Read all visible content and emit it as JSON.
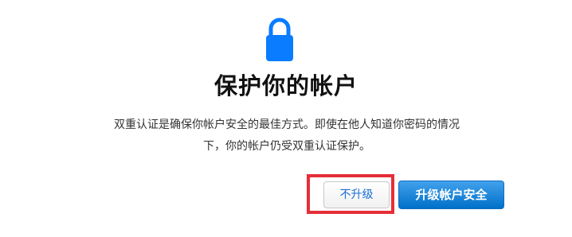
{
  "header": {
    "icon": "lock-icon",
    "title": "保护你的帐户"
  },
  "body": {
    "description_line1": "双重认证是确保你帐户安全的最佳方式。即使在他人知道你密码的情况",
    "description_line2": "下，你的帐户仍受双重认证保护。"
  },
  "actions": {
    "decline_label": "不升级",
    "upgrade_label": "升级帐户安全"
  },
  "colors": {
    "lock": "#0a7cff",
    "primary_button": "#0070c9",
    "secondary_text": "#1a6fd4",
    "highlight_border": "#e62e38"
  }
}
